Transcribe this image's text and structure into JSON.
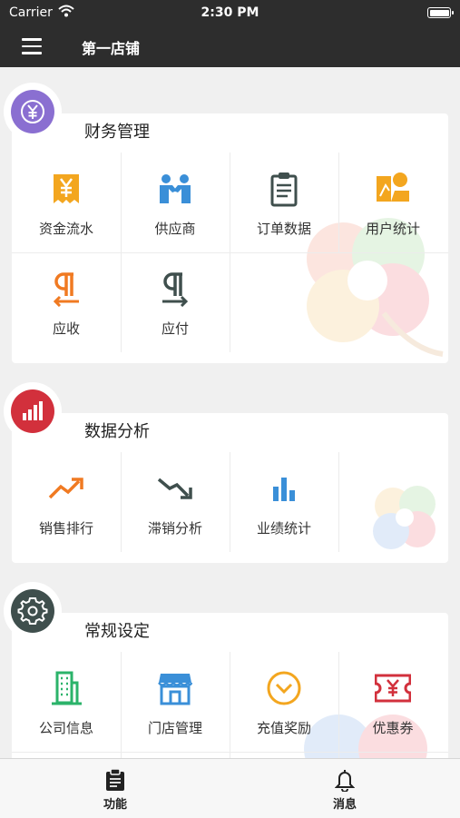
{
  "status_bar": {
    "carrier": "Carrier",
    "time": "2:30 PM"
  },
  "nav": {
    "title": "第一店铺",
    "menu_icon": "hamburger-menu-icon"
  },
  "sections": [
    {
      "title": "财务管理",
      "icon": "yuan-icon",
      "color": "#8a6fd1",
      "items": [
        {
          "label": "资金流水",
          "icon": "receipt-yuan-icon",
          "color": "#f3a61f"
        },
        {
          "label": "供应商",
          "icon": "handshake-people-icon",
          "color": "#3a8fd8"
        },
        {
          "label": "订单数据",
          "icon": "clipboard-icon",
          "color": "#3f4f4d"
        },
        {
          "label": "用户统计",
          "icon": "user-stats-icon",
          "color": "#f3a61f"
        },
        {
          "label": "应收",
          "icon": "paragraph-arrow-left-icon",
          "color": "#f07a22"
        },
        {
          "label": "应付",
          "icon": "paragraph-arrow-right-icon",
          "color": "#3f4f4d"
        }
      ]
    },
    {
      "title": "数据分析",
      "icon": "bar-chart-icon",
      "color": "#d2303c",
      "items": [
        {
          "label": "销售排行",
          "icon": "trend-up-icon",
          "color": "#f07a22"
        },
        {
          "label": "滞销分析",
          "icon": "trend-down-icon",
          "color": "#3f4f4d"
        },
        {
          "label": "业绩统计",
          "icon": "bars-icon",
          "color": "#3a8fd8"
        }
      ]
    },
    {
      "title": "常规设定",
      "icon": "gear-icon",
      "color": "#3f4f4d",
      "items": [
        {
          "label": "公司信息",
          "icon": "building-icon",
          "color": "#2bb36a"
        },
        {
          "label": "门店管理",
          "icon": "storefront-icon",
          "color": "#3a8fd8"
        },
        {
          "label": "充值奖励",
          "icon": "chevron-circle-icon",
          "color": "#f3a61f"
        },
        {
          "label": "优惠券",
          "icon": "coupon-icon",
          "color": "#d2303c"
        }
      ]
    }
  ],
  "tabs": [
    {
      "label": "功能",
      "icon": "clipboard-tab-icon"
    },
    {
      "label": "消息",
      "icon": "bell-icon"
    }
  ]
}
